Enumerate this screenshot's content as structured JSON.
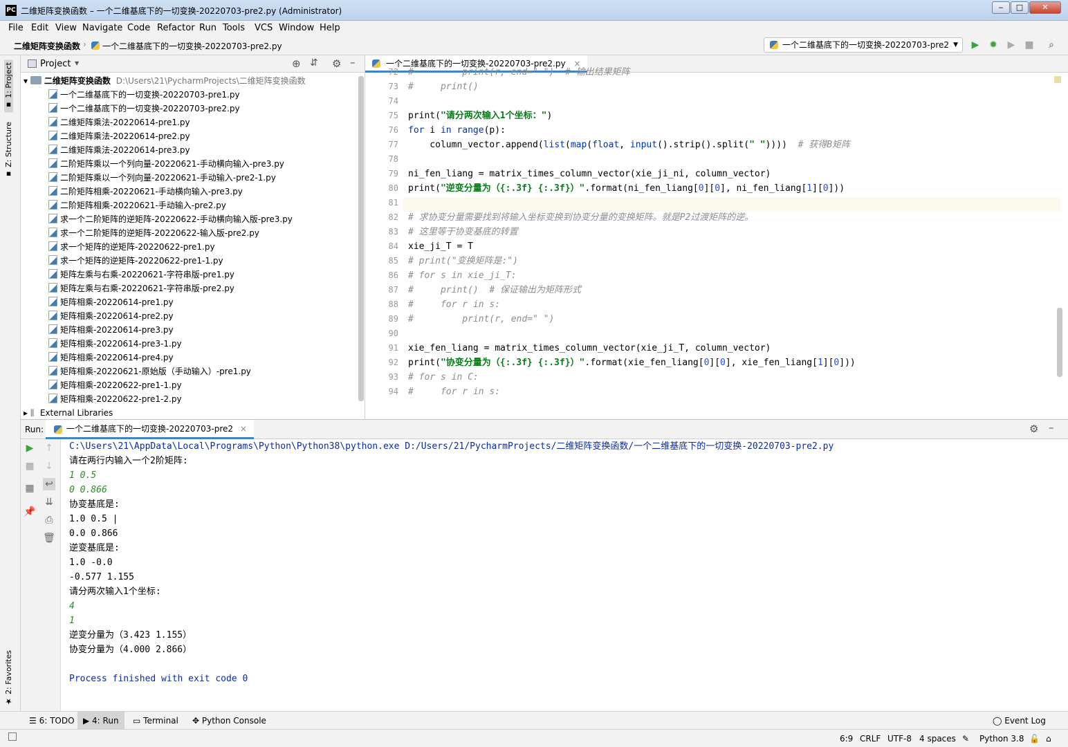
{
  "window": {
    "title": "二维矩阵变换函数 – 一个二维基底下的一切变换-20220703-pre2.py (Administrator)",
    "app_icon": "PC",
    "min": "‒",
    "max": "□",
    "close": "✕"
  },
  "menu": [
    "File",
    "Edit",
    "View",
    "Navigate",
    "Code",
    "Refactor",
    "Run",
    "Tools",
    "VCS",
    "Window",
    "Help"
  ],
  "nav": {
    "project": "二维矩阵变换函数",
    "file": "一个二维基底下的一切变换-20220703-pre2.py",
    "run_config": "一个二维基底下的一切变换-20220703-pre2"
  },
  "side_tabs": {
    "project": "1: Project",
    "structure": "Z: Structure",
    "favorites": "2: Favorites"
  },
  "project_panel": {
    "title": "Project",
    "root_name": "二维矩阵变换函数",
    "root_path": "D:\\Users\\21\\PycharmProjects\\二维矩阵变换函数",
    "files": [
      "一个二维基底下的一切变换-20220703-pre1.py",
      "一个二维基底下的一切变换-20220703-pre2.py",
      "二维矩阵乘法-20220614-pre1.py",
      "二维矩阵乘法-20220614-pre2.py",
      "二维矩阵乘法-20220614-pre3.py",
      "二阶矩阵乘以一个列向量-20220621-手动横向输入-pre3.py",
      "二阶矩阵乘以一个列向量-20220621-手动输入-pre2-1.py",
      "二阶矩阵相乘-20220621-手动横向输入-pre3.py",
      "二阶矩阵相乘-20220621-手动输入-pre2.py",
      "求一个二阶矩阵的逆矩阵-20220622-手动横向输入版-pre3.py",
      "求一个二阶矩阵的逆矩阵-20220622-输入版-pre2.py",
      "求一个矩阵的逆矩阵-20220622-pre1.py",
      "求一个矩阵的逆矩阵-20220622-pre1-1.py",
      "矩阵左乘与右乘-20220621-字符串版-pre1.py",
      "矩阵左乘与右乘-20220621-字符串版-pre2.py",
      "矩阵相乘-20220614-pre1.py",
      "矩阵相乘-20220614-pre2.py",
      "矩阵相乘-20220614-pre3.py",
      "矩阵相乘-20220614-pre3-1.py",
      "矩阵相乘-20220614-pre4.py",
      "矩阵相乘-20220621-原始版（手动输入）-pre1.py",
      "矩阵相乘-20220622-pre1-1.py",
      "矩阵相乘-20220622-pre1-2.py"
    ],
    "external": "External Libraries"
  },
  "editor": {
    "tab": "一个二维基底下的一切变换-20220703-pre2.py",
    "line_numbers": [
      "72",
      "73",
      "74",
      "75",
      "76",
      "77",
      "78",
      "79",
      "80",
      "81",
      "82",
      "83",
      "84",
      "85",
      "86",
      "87",
      "88",
      "89",
      "90",
      "91",
      "92",
      "93",
      "94"
    ],
    "current_line": "81"
  },
  "run": {
    "label": "Run:",
    "tab": "一个二维基底下的一切变换-20220703-pre2",
    "output": [
      {
        "t": "cmd",
        "text": "C:\\Users\\21\\AppData\\Local\\Programs\\Python\\Python38\\python.exe D:/Users/21/PycharmProjects/二维矩阵变换函数/一个二维基底下的一切变换-20220703-pre2.py"
      },
      {
        "t": "out",
        "text": "请在两行内输入一个2阶矩阵:"
      },
      {
        "t": "inp",
        "text": "1 0.5"
      },
      {
        "t": "inp",
        "text": "0 0.866"
      },
      {
        "t": "out",
        "text": "协变基底是:"
      },
      {
        "t": "out",
        "text": "1.0 0.5 |"
      },
      {
        "t": "out",
        "text": "0.0 0.866"
      },
      {
        "t": "out",
        "text": "逆变基底是:"
      },
      {
        "t": "out",
        "text": "1.0 -0.0"
      },
      {
        "t": "out",
        "text": "-0.577 1.155"
      },
      {
        "t": "out",
        "text": "请分两次输入1个坐标:"
      },
      {
        "t": "inp",
        "text": "4"
      },
      {
        "t": "inp",
        "text": "1"
      },
      {
        "t": "out",
        "text": "逆变分量为（3.423 1.155）"
      },
      {
        "t": "out",
        "text": "协变分量为（4.000 2.866）"
      },
      {
        "t": "out",
        "text": ""
      },
      {
        "t": "proc",
        "text": "Process finished with exit code 0"
      }
    ]
  },
  "bottom_tabs": [
    {
      "label": "6: TODO",
      "icon": "list-icon"
    },
    {
      "label": "4: Run",
      "icon": "run-icon",
      "active": true
    },
    {
      "label": "Terminal",
      "icon": "terminal-icon"
    },
    {
      "label": "Python Console",
      "icon": "python-icon"
    }
  ],
  "event_log": "Event Log",
  "status": {
    "position": "6:9",
    "line_sep": "CRLF",
    "encoding": "UTF-8",
    "indent": "4 spaces",
    "interpreter": "Python 3.8"
  }
}
